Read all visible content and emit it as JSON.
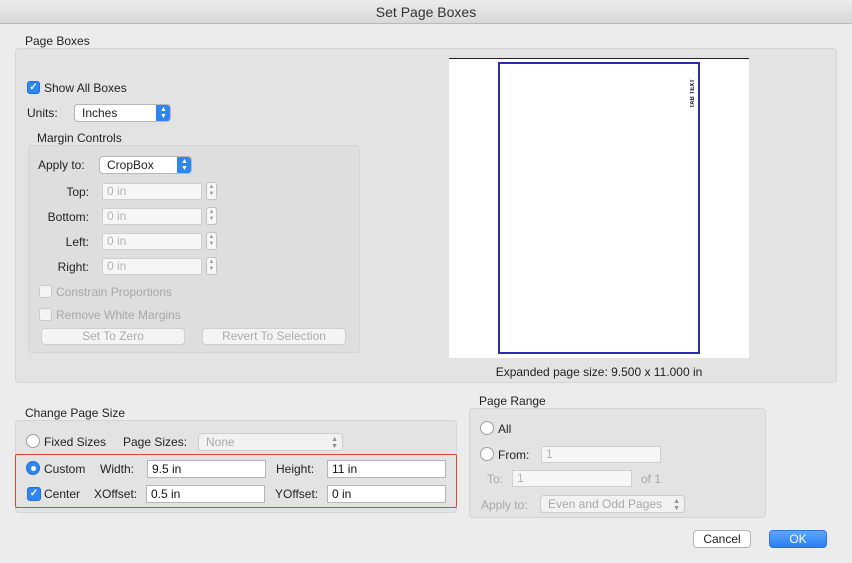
{
  "window": {
    "title": "Set Page Boxes"
  },
  "page_boxes": {
    "group_title": "Page Boxes",
    "show_all_boxes_label": "Show All Boxes",
    "show_all_boxes_checked": true,
    "units_label": "Units:",
    "units_value": "Inches",
    "margin_controls": {
      "title": "Margin Controls",
      "apply_to_label": "Apply to:",
      "apply_to_value": "CropBox",
      "top_label": "Top:",
      "top_value": "0 in",
      "bottom_label": "Bottom:",
      "bottom_value": "0 in",
      "left_label": "Left:",
      "left_value": "0 in",
      "right_label": "Right:",
      "right_value": "0 in",
      "constrain_label": "Constrain Proportions",
      "remove_white_label": "Remove White Margins",
      "set_to_zero_label": "Set To Zero",
      "revert_label": "Revert To Selection"
    },
    "preview": {
      "page_text": "TAB TEXT",
      "expanded_size_text": "Expanded page size: 9.500 x 11.000 in",
      "box_color": "#2b2bb0"
    }
  },
  "change_page_size": {
    "group_title": "Change Page Size",
    "fixed_sizes_label": "Fixed Sizes",
    "page_sizes_label": "Page Sizes:",
    "page_sizes_value": "None",
    "custom_label": "Custom",
    "custom_selected": true,
    "width_label": "Width:",
    "width_value": "9.5 in",
    "height_label": "Height:",
    "height_value": "11 in",
    "center_label": "Center",
    "center_checked": true,
    "xoffset_label": "XOffset:",
    "xoffset_value": "0.5 in",
    "yoffset_label": "YOffset:",
    "yoffset_value": "0 in",
    "highlight_color": "#d9473b"
  },
  "page_range": {
    "group_title": "Page Range",
    "all_label": "All",
    "from_label": "From:",
    "from_value": "1",
    "to_label": "To:",
    "to_value": "1",
    "of_label": "of 1",
    "apply_to_label": "Apply to:",
    "apply_to_value": "Even and Odd Pages"
  },
  "buttons": {
    "cancel_label": "Cancel",
    "ok_label": "OK",
    "accent": "#2f86f3"
  }
}
